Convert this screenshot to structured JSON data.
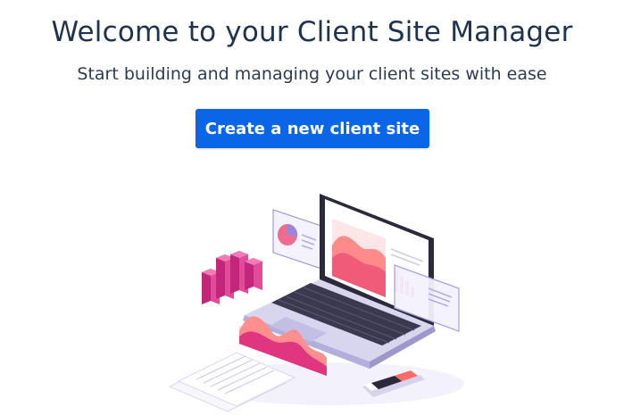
{
  "header": {
    "title": "Welcome to your Client Site Manager",
    "subtitle": "Start building and managing your client sites with ease"
  },
  "cta": {
    "label": "Create a new client site"
  },
  "illustration": {
    "icon": "laptop-analytics-illustration"
  },
  "colors": {
    "title": "#20334d",
    "button": "#0a66e6",
    "accent_pink": "#e0357f",
    "accent_coral": "#ff7a7a",
    "accent_purple": "#8b7fd8"
  }
}
